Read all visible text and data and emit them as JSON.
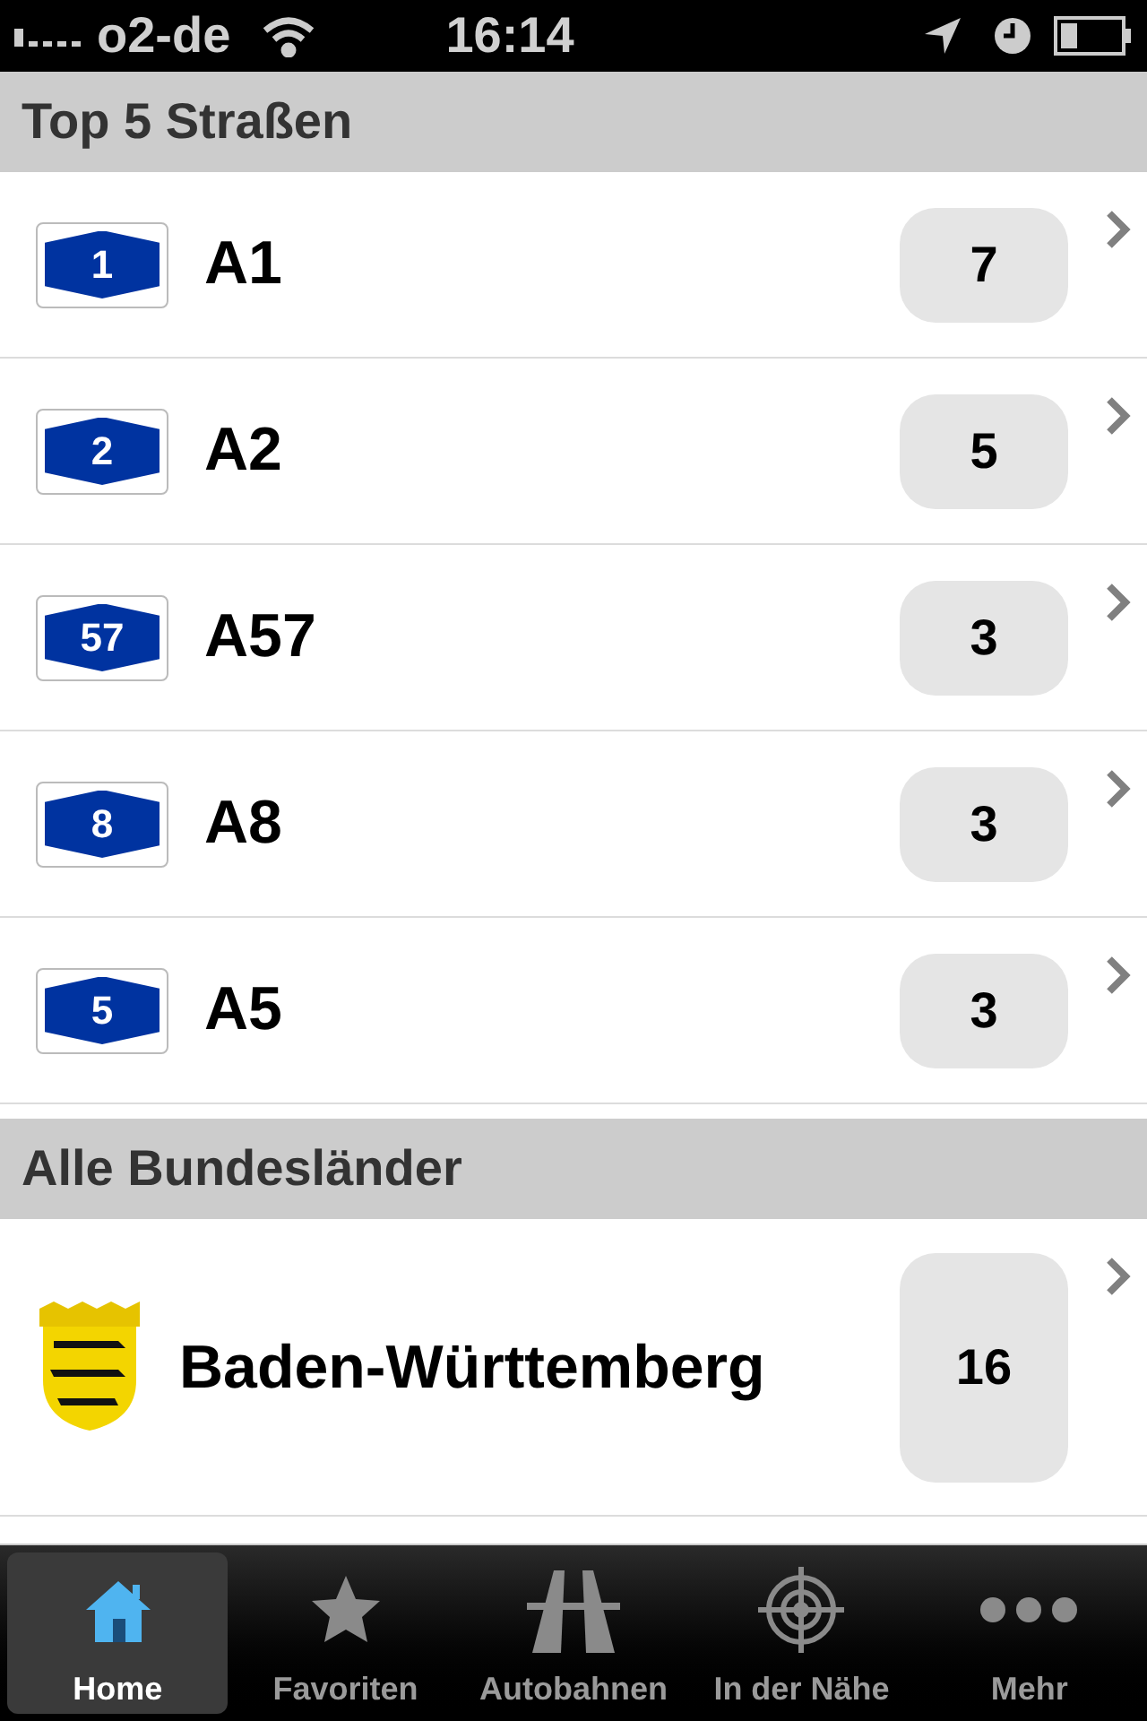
{
  "status_bar": {
    "carrier": "o2-de",
    "time": "16:14"
  },
  "sections": [
    {
      "title": "Top 5 Straßen",
      "rows": [
        {
          "kind": "autobahn",
          "sign": "1",
          "name": "A1",
          "count": "7"
        },
        {
          "kind": "autobahn",
          "sign": "2",
          "name": "A2",
          "count": "5"
        },
        {
          "kind": "autobahn",
          "sign": "57",
          "name": "A57",
          "count": "3"
        },
        {
          "kind": "autobahn",
          "sign": "8",
          "name": "A8",
          "count": "3"
        },
        {
          "kind": "autobahn",
          "sign": "5",
          "name": "A5",
          "count": "3"
        }
      ]
    },
    {
      "title": "Alle Bundesländer",
      "rows": [
        {
          "kind": "state",
          "name": "Baden-Württemberg",
          "count": "16"
        }
      ]
    }
  ],
  "tabs": [
    {
      "kind": "home",
      "label": "Home",
      "selected": true
    },
    {
      "kind": "star",
      "label": "Favoriten",
      "selected": false
    },
    {
      "kind": "road",
      "label": "Autobahnen",
      "selected": false
    },
    {
      "kind": "target",
      "label": "In der Nähe",
      "selected": false
    },
    {
      "kind": "more",
      "label": "Mehr",
      "selected": false
    }
  ]
}
